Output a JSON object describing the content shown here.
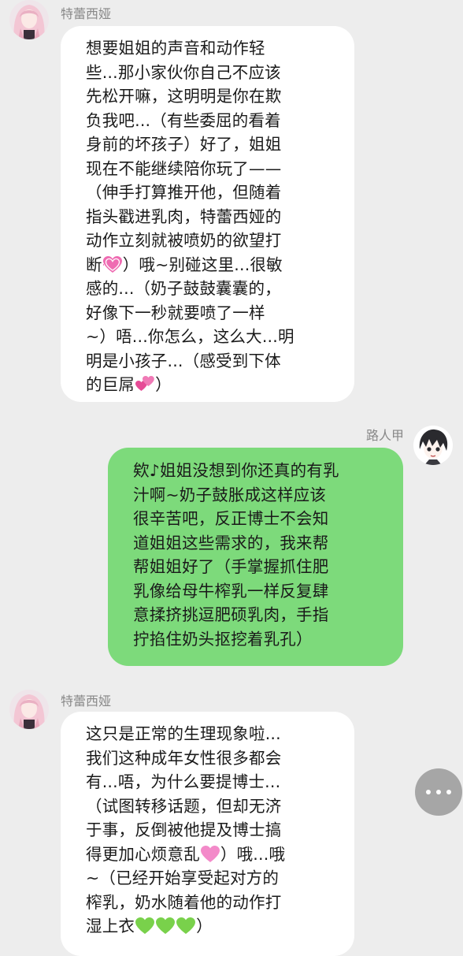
{
  "colors": {
    "background": "#ededed",
    "incoming_bubble": "#ffffff",
    "outgoing_bubble": "#7dda7b",
    "sender_name": "#888888",
    "more_button": "#a6a6a6"
  },
  "messages": [
    {
      "sender": "特蕾西娅",
      "avatar_icon": "anime-girl-pink-hair-avatar",
      "direction": "incoming",
      "lines": [
        "想要姐姐的声音和动作轻",
        "些...那小家伙你自己不应该",
        "先松开嘛，这明明是你在欺",
        "负我吧...（有些委屈的看着",
        "身前的坏孩子）好了，姐姐",
        "现在不能继续陪你玩了——",
        "（伸手打算推开他，但随着",
        "指头戳进乳肉，特蕾西娅的",
        "动作立刻就被喷奶的欲望打",
        "断",
        "）哦~别碰这里...很敏",
        "感的...（奶子鼓鼓囊囊的，",
        "好像下一秒就要喷了一样",
        "~）唔...你怎么，这么大...明",
        "明是小孩子...（感受到下体",
        "的巨屌",
        "）"
      ],
      "emoji_icons": [
        "vibrating-heart-icon",
        "two-hearts-icon"
      ]
    },
    {
      "sender": "路人甲",
      "avatar_icon": "anime-boy-dark-hair-avatar",
      "direction": "outgoing",
      "lines": [
        "欸♪姐姐没想到你还真的有乳",
        "汁啊~奶子鼓胀成这样应该",
        "很辛苦吧，反正博士不会知",
        "道姐姐这些需求的，我来帮",
        "帮姐姐好了（手掌握抓住肥",
        "乳像给母牛榨乳一样反复肆",
        "意揉挤挑逗肥硕乳肉，手指",
        "拧掐住奶头抠挖着乳孔）"
      ]
    },
    {
      "sender": "特蕾西娅",
      "avatar_icon": "anime-girl-pink-hair-avatar",
      "direction": "incoming",
      "lines": [
        "这只是正常的生理现象啦...",
        "我们这种成年女性很多都会",
        "有...唔，为什么要提博士...",
        "（试图转移话题，但却无济",
        "于事，反倒被他提及博士搞",
        "得更加心烦意乱",
        "）哦...哦",
        "~（已经开始享受起对方的",
        "榨乳，奶水随着他的动作打",
        "湿上衣",
        "）"
      ],
      "emoji_icons": [
        "pink-heart-icon",
        "green-heart-icon"
      ]
    }
  ],
  "more_button": {
    "icon": "more-dots-icon"
  }
}
